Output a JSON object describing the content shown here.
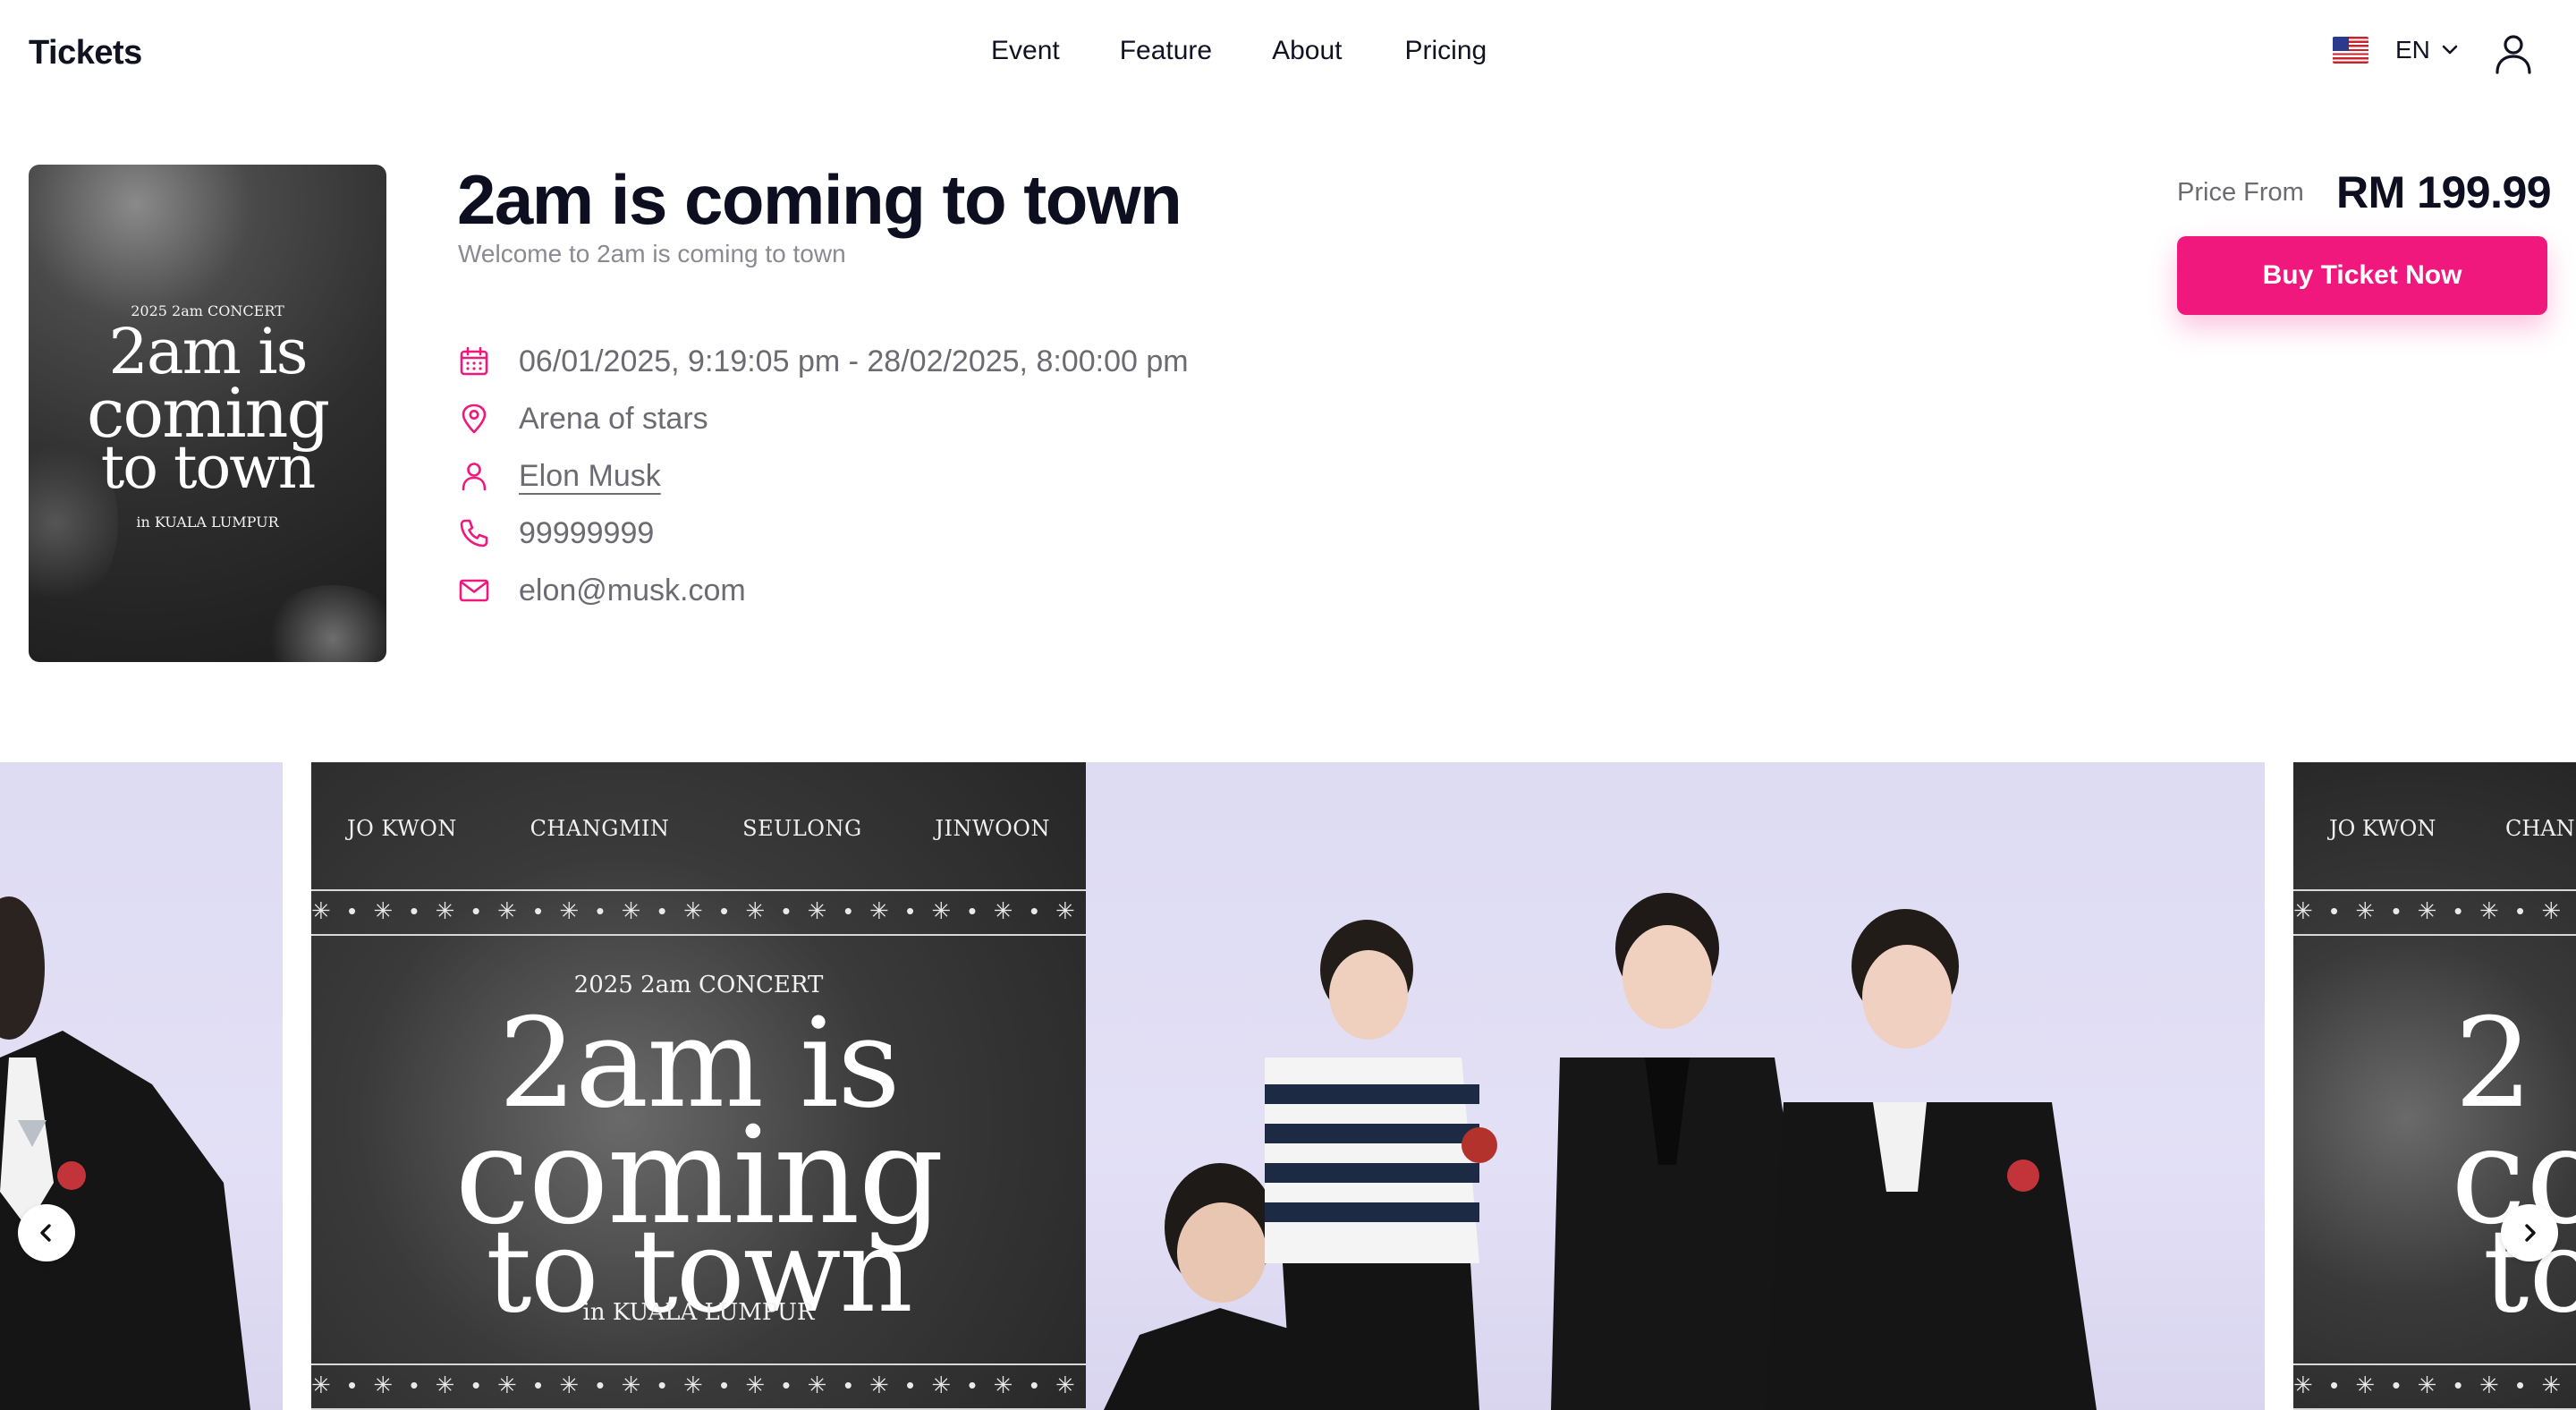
{
  "header": {
    "logo": "Tickets",
    "nav": [
      "Event",
      "Feature",
      "About",
      "Pricing"
    ],
    "language": "EN"
  },
  "event": {
    "poster": {
      "line1": "2025 2am CONCERT",
      "line2": "2am is",
      "line3": "coming",
      "line4": "to town",
      "line5": "in KUALA LUMPUR"
    },
    "title": "2am is coming to town",
    "subtitle": "Welcome to 2am is coming to town",
    "datetime": "06/01/2025, 9:19:05 pm - 28/02/2025, 8:00:00 pm",
    "venue": "Arena of stars",
    "organizer": "Elon Musk",
    "phone": "99999999",
    "email": "elon@musk.com"
  },
  "pricing": {
    "label": "Price From",
    "value": "RM 199.99",
    "button": "Buy Ticket Now"
  },
  "carousel": {
    "members": [
      "JO KWON",
      "CHANGMIN",
      "SEULONG",
      "JINWOON"
    ],
    "poster_heading": "2025 2am CONCERT",
    "poster_line1": "2am is",
    "poster_line2": "coming",
    "poster_line3": "to town",
    "poster_location": "in KUALA LUMPUR",
    "partial_members": [
      "JO KWON",
      "CHAN"
    ]
  },
  "colors": {
    "accent": "#f0187c",
    "text": "#0d0e1f",
    "muted": "#6b6b72"
  }
}
